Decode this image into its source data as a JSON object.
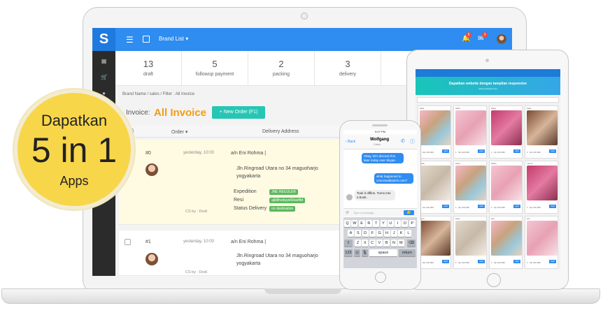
{
  "promo": {
    "line1": "Dapatkan",
    "line2": "5 in 1",
    "line3": "Apps"
  },
  "app": {
    "brand_list": "Brand List",
    "notifications_count": "5",
    "messages_count": "3",
    "stats": [
      {
        "value": "13",
        "label": "draft"
      },
      {
        "value": "5",
        "label": "followup payment"
      },
      {
        "value": "2",
        "label": "packing"
      },
      {
        "value": "3",
        "label": "delivery"
      }
    ],
    "breadcrumb": "Brand Name  /  sales  /  Filter : All Invoice",
    "invoice_label": "Invoice:",
    "invoice_title": "All Invoice",
    "new_order": "+ New Order (F1)",
    "headers": {
      "order": "Order",
      "delivery": "Delivery Address"
    },
    "rows": [
      {
        "id": "#0",
        "date": "yesterday, 10:00",
        "customer": "a/n Eni Rohma |",
        "address": "Jln.Ringroad Utara no 34 maguoharjo yogyakarta",
        "cs": "CS by : Dodi",
        "expedition_label": "Expedition",
        "expedition": "JNE REGULER",
        "resi_label": "Resi",
        "resi": "ajkl8hsduye0ldasf8d",
        "status_label": "Status Delivery",
        "status": "on destination"
      },
      {
        "id": "#1",
        "date": "yesterday, 10:00",
        "customer": "a/n Eni Rohma |",
        "address": "Jln.Ringroad Utara no 34 maguoharjo yogyakarta",
        "cs": "CS by : Dodi"
      }
    ]
  },
  "phone": {
    "time": "9:07 PM",
    "contact": "Wolfgang",
    "back": "Back",
    "status": "Online",
    "messages": [
      "Okay, let's discuss this later today over Skype.",
      "what happened to conceivablytech.com?",
      "Took it offline. Turns into a book."
    ],
    "placeholder": "Type a message...",
    "keys1": [
      "Q",
      "W",
      "E",
      "R",
      "T",
      "Y",
      "U",
      "I",
      "O",
      "P"
    ],
    "keys2": [
      "A",
      "S",
      "D",
      "F",
      "G",
      "H",
      "J",
      "K",
      "L"
    ],
    "keys3": [
      "Z",
      "X",
      "C",
      "V",
      "B",
      "N",
      "M"
    ],
    "space": "space",
    "return": "return",
    "num": "123"
  },
  "tablet": {
    "banner": "Dapatkan website dengan tampilan responsive",
    "banner_sub": "www.yoshoppe.com",
    "products": [
      "kaka",
      "lalalu",
      "baba",
      "kaka",
      "lalalu",
      "baba",
      "lalaku",
      "mama",
      "papa",
      "kaka",
      "lala",
      "lolo"
    ],
    "price": "1 · Rp 100.000",
    "buy": "Add"
  },
  "colors": {
    "primary": "#2f8cf0",
    "accent": "#f39c12",
    "badge": "#f8d64a",
    "success": "#5cb85c"
  }
}
